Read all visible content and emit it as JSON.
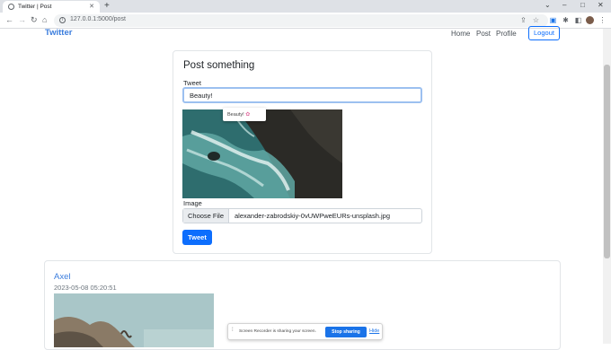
{
  "browser": {
    "tab_title": "Twitter | Post",
    "url": "127.0.0.1:5000/post",
    "icons": [
      "back-icon",
      "forward-icon",
      "reload-icon",
      "home-icon",
      "share-icon",
      "star-icon",
      "translate-icon",
      "extensions-icon",
      "sidepanel-icon",
      "profile-avatar",
      "menu-icon"
    ]
  },
  "navbar": {
    "brand": "Twitter",
    "links": [
      "Home",
      "Post",
      "Profile"
    ],
    "logout": "Logout"
  },
  "post_form": {
    "title": "Post something",
    "tweet_label": "Tweet",
    "tweet_value": "Beauty!",
    "suggestion_text": "Beauty!",
    "image_label": "Image",
    "choose_file": "Choose File",
    "file_name": "alexander-zabrodskiy-0vUWPweEURs-unsplash.jpg",
    "submit": "Tweet"
  },
  "feed": [
    {
      "user": "Axel",
      "timestamp": "2023-05-08 05:20:51"
    }
  ],
  "screen_share": {
    "message": "Screen Recorder is sharing your screen.",
    "stop": "Stop sharing",
    "hide": "Hide"
  },
  "colors": {
    "brand": "#3b7ddd",
    "primary": "#0d6efd",
    "chrome_tabbar": "#dee1e6"
  }
}
